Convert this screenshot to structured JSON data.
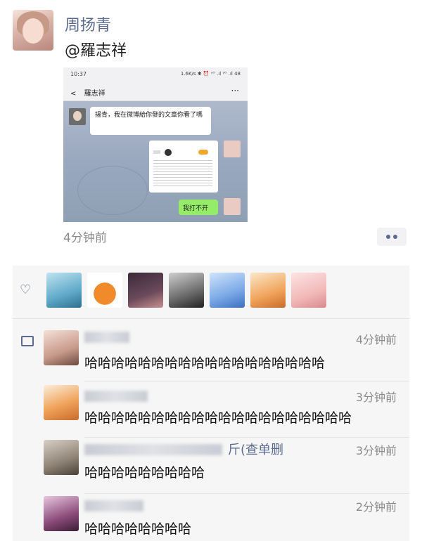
{
  "post": {
    "author": "周扬青",
    "text": "@羅志祥",
    "time": "4分钟前"
  },
  "screenshot": {
    "status_time": "10:37",
    "status_right": "1.6K/s ✱ ⏰ ᵞᴼ .ıl ᵞᴼ .ıl 48",
    "nav_back": "<",
    "nav_title": "羅志祥",
    "nav_more": "···",
    "message_incoming": "揚青，我在微博給你發的文章你看了嗎",
    "message_outgoing": "我打不开"
  },
  "icons": {
    "heart": "heart-icon",
    "comment": "comment-icon",
    "more": "more-icon"
  },
  "comments": [
    {
      "time": "4分钟前",
      "text": "哈哈哈哈哈哈哈哈哈哈哈哈哈哈哈哈哈哈"
    },
    {
      "time": "3分钟前",
      "text": "哈哈哈哈哈哈哈哈哈哈哈哈哈哈哈哈哈哈哈哈"
    },
    {
      "name_tail": "斤(查单删",
      "time": "3分钟前",
      "text": "哈哈哈哈哈哈哈哈哈"
    },
    {
      "time": "2分钟前",
      "text": "哈哈哈哈哈哈哈哈"
    }
  ],
  "colors": {
    "link": "#5a6b8f",
    "wechat_green": "#95ec69"
  }
}
